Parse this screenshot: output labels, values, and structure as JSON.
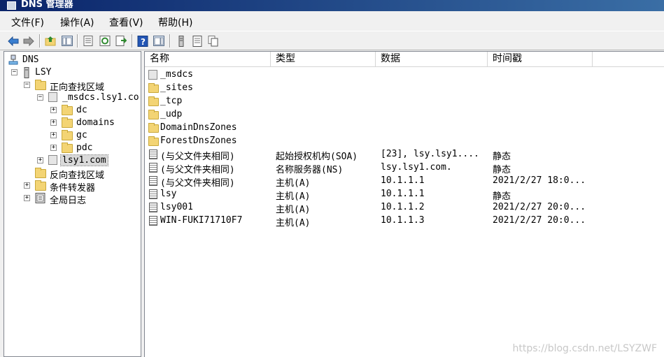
{
  "window": {
    "title": "DNS 管理器"
  },
  "menu": [
    {
      "label": "文件(F)"
    },
    {
      "label": "操作(A)"
    },
    {
      "label": "查看(V)"
    },
    {
      "label": "帮助(H)"
    }
  ],
  "toolbar": {
    "buttons": [
      "back-arrow",
      "forward-arrow",
      "up-folder",
      "show-hide-tree",
      "properties",
      "refresh",
      "export-list",
      "help",
      "show-hide-action-pane",
      "server",
      "records",
      "copy"
    ]
  },
  "tree": {
    "root": "DNS",
    "server": "LSY",
    "forward_zones": "正向查找区域",
    "msdcs_zone": "_msdcs.lsy1.co",
    "dc": "dc",
    "domains": "domains",
    "gc": "gc",
    "pdc": "pdc",
    "lsy1_zone": "lsy1.com",
    "reverse_zones": "反向查找区域",
    "conditional_forwarders": "条件转发器",
    "global_logs": "全局日志"
  },
  "list": {
    "headers": {
      "name": "名称",
      "type": "类型",
      "data": "数据",
      "timestamp": "时间戳"
    },
    "rows": [
      {
        "name": "_msdcs",
        "type": "",
        "data": "",
        "timestamp": "",
        "icon": "zone-icon"
      },
      {
        "name": "_sites",
        "type": "",
        "data": "",
        "timestamp": "",
        "icon": "folder-icon"
      },
      {
        "name": "_tcp",
        "type": "",
        "data": "",
        "timestamp": "",
        "icon": "folder-icon"
      },
      {
        "name": "_udp",
        "type": "",
        "data": "",
        "timestamp": "",
        "icon": "folder-icon"
      },
      {
        "name": "DomainDnsZones",
        "type": "",
        "data": "",
        "timestamp": "",
        "icon": "folder-icon"
      },
      {
        "name": "ForestDnsZones",
        "type": "",
        "data": "",
        "timestamp": "",
        "icon": "folder-icon"
      },
      {
        "name": "(与父文件夹相同)",
        "type": "起始授权机构(SOA)",
        "data": "[23], lsy.lsy1....",
        "timestamp": "静态",
        "icon": "record-icon"
      },
      {
        "name": "(与父文件夹相同)",
        "type": "名称服务器(NS)",
        "data": "lsy.lsy1.com.",
        "timestamp": "静态",
        "icon": "record-icon"
      },
      {
        "name": "(与父文件夹相同)",
        "type": "主机(A)",
        "data": "10.1.1.1",
        "timestamp": "2021/2/27 18:0...",
        "icon": "record-icon"
      },
      {
        "name": "lsy",
        "type": "主机(A)",
        "data": "10.1.1.1",
        "timestamp": "静态",
        "icon": "record-icon"
      },
      {
        "name": "lsy001",
        "type": "主机(A)",
        "data": "10.1.1.2",
        "timestamp": "2021/2/27 20:0...",
        "icon": "record-icon"
      },
      {
        "name": "WIN-FUKI71710F7",
        "type": "主机(A)",
        "data": "10.1.1.3",
        "timestamp": "2021/2/27 20:0...",
        "icon": "record-icon"
      }
    ]
  },
  "watermark": "https://blog.csdn.net/LSYZWF"
}
